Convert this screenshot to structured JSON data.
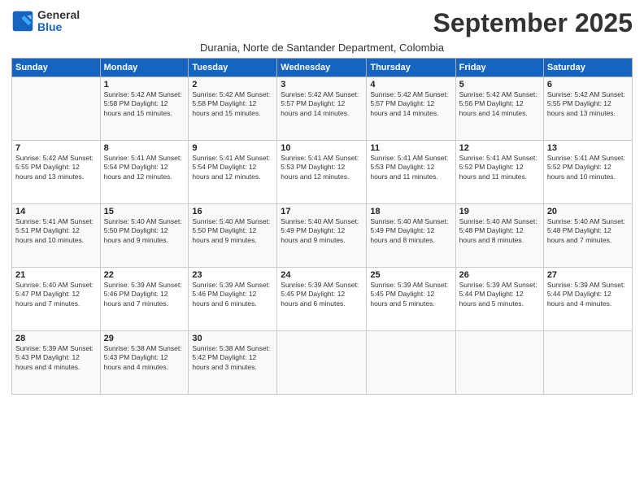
{
  "header": {
    "logo_line1": "General",
    "logo_line2": "Blue",
    "month_title": "September 2025",
    "subtitle": "Durania, Norte de Santander Department, Colombia"
  },
  "days_of_week": [
    "Sunday",
    "Monday",
    "Tuesday",
    "Wednesday",
    "Thursday",
    "Friday",
    "Saturday"
  ],
  "weeks": [
    [
      {
        "day": "",
        "info": ""
      },
      {
        "day": "1",
        "info": "Sunrise: 5:42 AM\nSunset: 5:58 PM\nDaylight: 12 hours\nand 15 minutes."
      },
      {
        "day": "2",
        "info": "Sunrise: 5:42 AM\nSunset: 5:58 PM\nDaylight: 12 hours\nand 15 minutes."
      },
      {
        "day": "3",
        "info": "Sunrise: 5:42 AM\nSunset: 5:57 PM\nDaylight: 12 hours\nand 14 minutes."
      },
      {
        "day": "4",
        "info": "Sunrise: 5:42 AM\nSunset: 5:57 PM\nDaylight: 12 hours\nand 14 minutes."
      },
      {
        "day": "5",
        "info": "Sunrise: 5:42 AM\nSunset: 5:56 PM\nDaylight: 12 hours\nand 14 minutes."
      },
      {
        "day": "6",
        "info": "Sunrise: 5:42 AM\nSunset: 5:55 PM\nDaylight: 12 hours\nand 13 minutes."
      }
    ],
    [
      {
        "day": "7",
        "info": "Sunrise: 5:42 AM\nSunset: 5:55 PM\nDaylight: 12 hours\nand 13 minutes."
      },
      {
        "day": "8",
        "info": "Sunrise: 5:41 AM\nSunset: 5:54 PM\nDaylight: 12 hours\nand 12 minutes."
      },
      {
        "day": "9",
        "info": "Sunrise: 5:41 AM\nSunset: 5:54 PM\nDaylight: 12 hours\nand 12 minutes."
      },
      {
        "day": "10",
        "info": "Sunrise: 5:41 AM\nSunset: 5:53 PM\nDaylight: 12 hours\nand 12 minutes."
      },
      {
        "day": "11",
        "info": "Sunrise: 5:41 AM\nSunset: 5:53 PM\nDaylight: 12 hours\nand 11 minutes."
      },
      {
        "day": "12",
        "info": "Sunrise: 5:41 AM\nSunset: 5:52 PM\nDaylight: 12 hours\nand 11 minutes."
      },
      {
        "day": "13",
        "info": "Sunrise: 5:41 AM\nSunset: 5:52 PM\nDaylight: 12 hours\nand 10 minutes."
      }
    ],
    [
      {
        "day": "14",
        "info": "Sunrise: 5:41 AM\nSunset: 5:51 PM\nDaylight: 12 hours\nand 10 minutes."
      },
      {
        "day": "15",
        "info": "Sunrise: 5:40 AM\nSunset: 5:50 PM\nDaylight: 12 hours\nand 9 minutes."
      },
      {
        "day": "16",
        "info": "Sunrise: 5:40 AM\nSunset: 5:50 PM\nDaylight: 12 hours\nand 9 minutes."
      },
      {
        "day": "17",
        "info": "Sunrise: 5:40 AM\nSunset: 5:49 PM\nDaylight: 12 hours\nand 9 minutes."
      },
      {
        "day": "18",
        "info": "Sunrise: 5:40 AM\nSunset: 5:49 PM\nDaylight: 12 hours\nand 8 minutes."
      },
      {
        "day": "19",
        "info": "Sunrise: 5:40 AM\nSunset: 5:48 PM\nDaylight: 12 hours\nand 8 minutes."
      },
      {
        "day": "20",
        "info": "Sunrise: 5:40 AM\nSunset: 5:48 PM\nDaylight: 12 hours\nand 7 minutes."
      }
    ],
    [
      {
        "day": "21",
        "info": "Sunrise: 5:40 AM\nSunset: 5:47 PM\nDaylight: 12 hours\nand 7 minutes."
      },
      {
        "day": "22",
        "info": "Sunrise: 5:39 AM\nSunset: 5:46 PM\nDaylight: 12 hours\nand 7 minutes."
      },
      {
        "day": "23",
        "info": "Sunrise: 5:39 AM\nSunset: 5:46 PM\nDaylight: 12 hours\nand 6 minutes."
      },
      {
        "day": "24",
        "info": "Sunrise: 5:39 AM\nSunset: 5:45 PM\nDaylight: 12 hours\nand 6 minutes."
      },
      {
        "day": "25",
        "info": "Sunrise: 5:39 AM\nSunset: 5:45 PM\nDaylight: 12 hours\nand 5 minutes."
      },
      {
        "day": "26",
        "info": "Sunrise: 5:39 AM\nSunset: 5:44 PM\nDaylight: 12 hours\nand 5 minutes."
      },
      {
        "day": "27",
        "info": "Sunrise: 5:39 AM\nSunset: 5:44 PM\nDaylight: 12 hours\nand 4 minutes."
      }
    ],
    [
      {
        "day": "28",
        "info": "Sunrise: 5:39 AM\nSunset: 5:43 PM\nDaylight: 12 hours\nand 4 minutes."
      },
      {
        "day": "29",
        "info": "Sunrise: 5:38 AM\nSunset: 5:43 PM\nDaylight: 12 hours\nand 4 minutes."
      },
      {
        "day": "30",
        "info": "Sunrise: 5:38 AM\nSunset: 5:42 PM\nDaylight: 12 hours\nand 3 minutes."
      },
      {
        "day": "",
        "info": ""
      },
      {
        "day": "",
        "info": ""
      },
      {
        "day": "",
        "info": ""
      },
      {
        "day": "",
        "info": ""
      }
    ]
  ]
}
